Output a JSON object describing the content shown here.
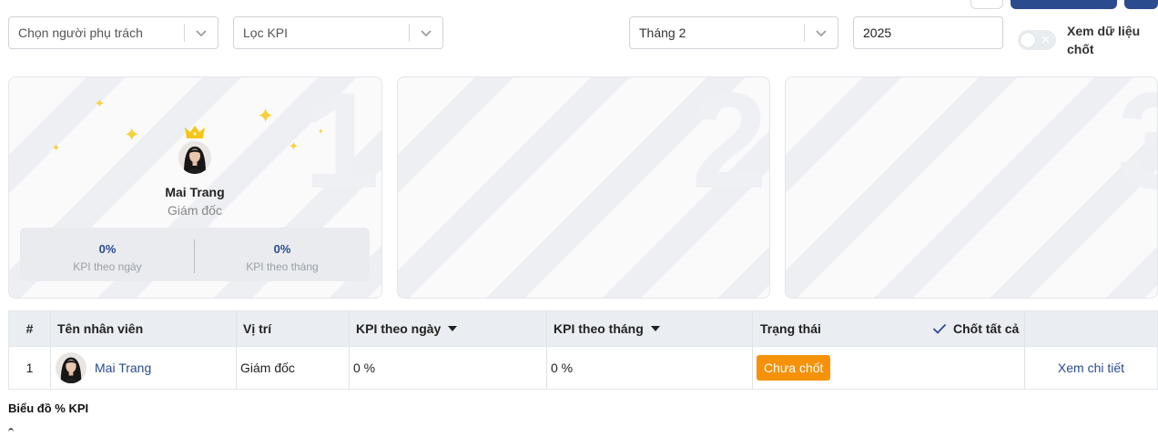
{
  "filters": {
    "assignee_placeholder": "Chọn người phụ trách",
    "kpi_placeholder": "Lọc KPI",
    "month_value": "Tháng 2",
    "year_value": "2025",
    "toggle_label": "Xem dữ liệu chốt"
  },
  "podium": [
    {
      "rank": "1",
      "name": "Mai Trang",
      "role": "Giám đốc",
      "kpi_day": "0%",
      "kpi_day_label": "KPI theo ngày",
      "kpi_month": "0%",
      "kpi_month_label": "KPI theo tháng"
    },
    {
      "rank": "2"
    },
    {
      "rank": "3"
    }
  ],
  "table": {
    "headers": {
      "index": "#",
      "name": "Tên nhân viên",
      "position": "Vị trí",
      "kpi_day": "KPI theo ngày",
      "kpi_month": "KPI theo tháng",
      "status": "Trạng thái",
      "close_all": "Chốt tất cả"
    },
    "rows": [
      {
        "index": "1",
        "name": "Mai Trang",
        "position": "Giám đốc",
        "kpi_day": "0 %",
        "kpi_month": "0 %",
        "status": "Chưa chốt",
        "action": "Xem chi tiết"
      }
    ]
  },
  "chart_section": {
    "title": "Biểu đồ % KPI"
  },
  "colors": {
    "primary": "#2b4b8f",
    "status_pending": "#f5920a",
    "crown": "#f5c518"
  }
}
